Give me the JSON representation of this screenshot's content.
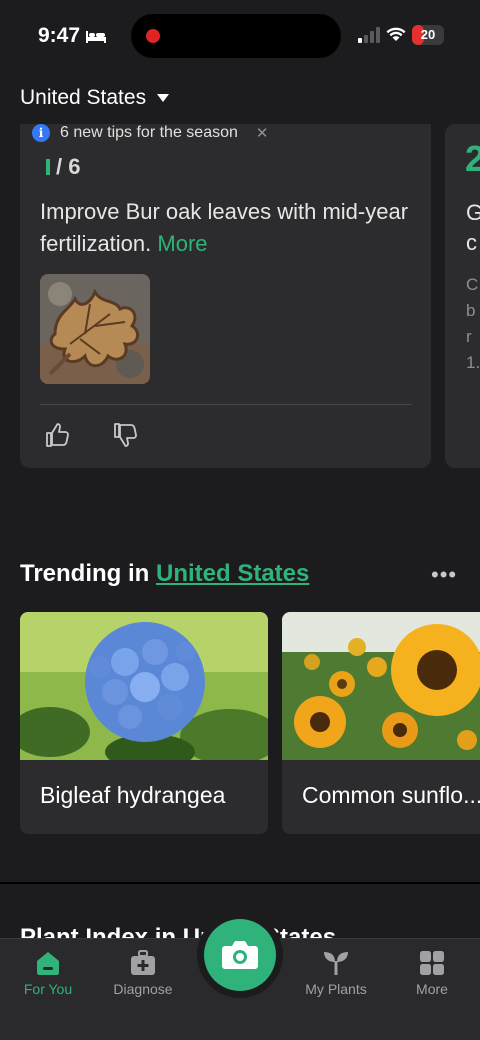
{
  "status_bar": {
    "time": "9:47",
    "battery_level": "20",
    "battery_fraction": 0.2,
    "icons": [
      "bed-icon",
      "recording-dot",
      "cellular-signal-icon",
      "wifi-icon",
      "battery-icon"
    ]
  },
  "header": {
    "country": "United States",
    "dropdown_icon": "caret-down-icon"
  },
  "tips": {
    "banner_text": "6 new tips for the season",
    "banner_close": "✕",
    "card": {
      "counter_current": "1",
      "counter_total": "/ 6",
      "text": "Improve Bur oak leaves with mid-year fertilization.",
      "more_label": "More",
      "image_icon": "bur-oak-leaf-image",
      "like_icon": "thumbs-up-icon",
      "dislike_icon": "thumbs-down-icon"
    },
    "next_card": {
      "counter_start": "2",
      "title_line1": "G",
      "title_line2": "c",
      "body_lines": [
        "C",
        "b",
        "r",
        "1."
      ]
    }
  },
  "trending": {
    "prefix": "Trending in",
    "country_link": "United States",
    "more_icon": "more-horizontal-icon",
    "plants": [
      {
        "name": "Bigleaf hydrangea",
        "image": "hydrangea-image"
      },
      {
        "name": "Common sunflo...",
        "image": "sunflower-image"
      }
    ]
  },
  "plant_index": {
    "title": "Plant Index in United States"
  },
  "tab_bar": {
    "tabs": [
      {
        "label": "For You",
        "icon": "home-icon",
        "active": true
      },
      {
        "label": "Diagnose",
        "icon": "first-aid-kit-icon",
        "active": false
      },
      {
        "label": "My Plants",
        "icon": "sprout-icon",
        "active": false
      },
      {
        "label": "More",
        "icon": "grid-icon",
        "active": false
      }
    ],
    "camera_icon": "camera-icon"
  },
  "colors": {
    "accent": "#2fb37a",
    "background": "#1c1c1e",
    "card": "#2c2c2e",
    "info_blue": "#3478f6",
    "recording_red": "#e02424"
  }
}
